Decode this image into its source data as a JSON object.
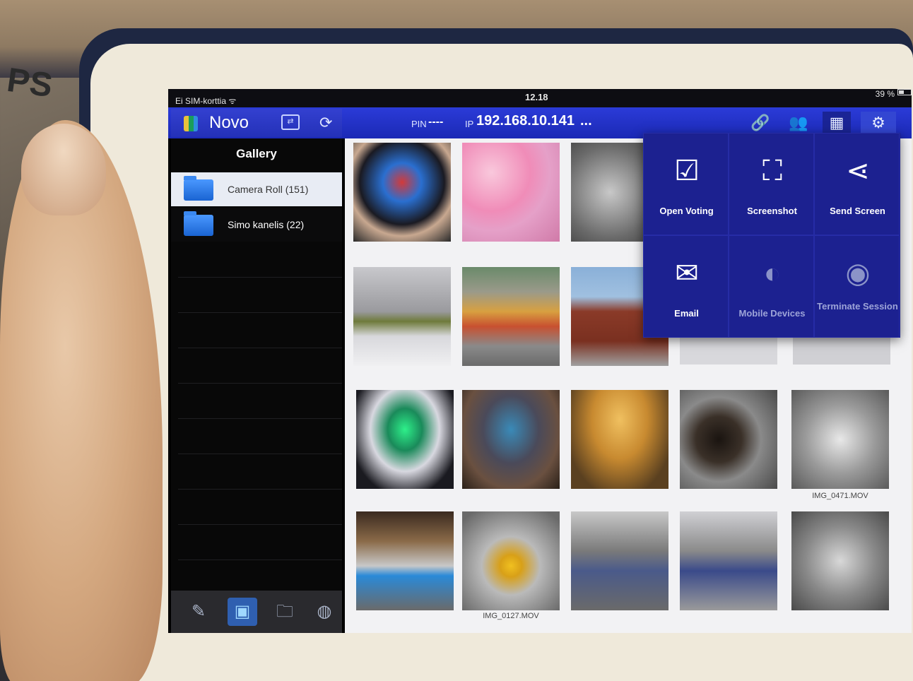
{
  "surroundings": {
    "box_text": "PS"
  },
  "status_bar": {
    "carrier": "Ei SIM-korttia ᯤ",
    "time": "12.18",
    "battery": "39 %"
  },
  "nav_bar": {
    "app_title": "Novo",
    "pin_label": "PIN",
    "pin_value": "----",
    "ip_label": "IP",
    "ip_value": "192.168.10.141",
    "more": "...",
    "icons": [
      "screen-share-icon",
      "refresh-icon",
      "link-icon",
      "users-icon",
      "grid-icon",
      "settings-icon"
    ]
  },
  "sidebar": {
    "title": "Gallery",
    "folders": [
      {
        "label": "Camera Roll (151)",
        "selected": true
      },
      {
        "label": "Simo kanelis (22)",
        "selected": false
      }
    ],
    "toolbar": [
      "pen-icon",
      "gallery-icon",
      "folder-icon",
      "web-icon"
    ]
  },
  "grid": {
    "captions": {
      "video_1": "IMG_0471.MOV",
      "video_2": "IMG_0127.MOV"
    }
  },
  "popover": {
    "items": [
      {
        "label": "Open Voting",
        "icon": "checkbox-icon"
      },
      {
        "label": "Screenshot",
        "icon": "screenshot-icon"
      },
      {
        "label": "Send Screen",
        "icon": "share-icon"
      },
      {
        "label": "Email",
        "icon": "email-icon"
      },
      {
        "label": "Mobile Devices",
        "icon": "mobile-devices-icon"
      },
      {
        "label": "Terminate Session",
        "icon": "terminate-icon"
      }
    ]
  },
  "colors": {
    "accent": "#1b29b5",
    "popover": "#1c2190",
    "selected_row": "#e8ecf4"
  }
}
